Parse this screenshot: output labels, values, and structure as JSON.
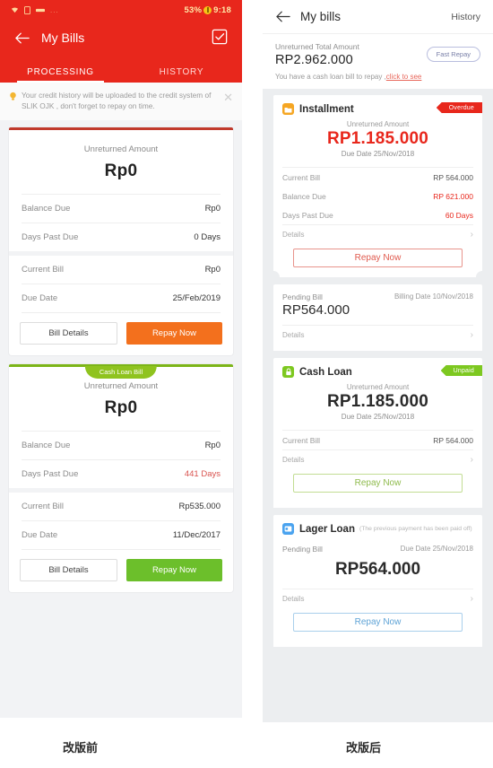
{
  "captions": {
    "before": "改版前",
    "after": "改版后"
  },
  "left_phone": {
    "statusbar": {
      "battery": "53%",
      "time": "9:18",
      "dots": "...",
      "icons": [
        "wifi-icon",
        "sim-card-icon",
        "signal-icon"
      ]
    },
    "navbar": {
      "title": "My Bills",
      "back_icon": "back-arrow-icon",
      "action_icon": "checkbox-list-icon"
    },
    "tabs": [
      {
        "label": "PROCESSING",
        "active": true
      },
      {
        "label": "HISTORY",
        "active": false
      }
    ],
    "notice": {
      "icon": "info-bulb-icon",
      "text": "Your credit history will be uploaded to the credit system of SLIK OJK , don't forget to repay on time.",
      "close_icon": "close-icon"
    },
    "cards": [
      {
        "accent": "#c0392b",
        "tag": null,
        "amount_label": "Unreturned Amount",
        "amount_value": "Rp0",
        "rows": [
          {
            "key": "Balance Due",
            "value": "Rp0",
            "danger": false
          },
          {
            "key": "Days Past Due",
            "value": "0 Days",
            "danger": false
          }
        ],
        "rows2": [
          {
            "key": "Current Bill",
            "value": "Rp0",
            "danger": false
          },
          {
            "key": "Due Date",
            "value": "25/Feb/2019",
            "danger": false
          }
        ],
        "btn_secondary": "Bill Details",
        "btn_primary": "Repay Now",
        "btn_primary_color": "#f3701d"
      },
      {
        "accent": "#7cb518",
        "tag": "Cash Loan Bill",
        "amount_label": "Unreturned Amount",
        "amount_value": "Rp0",
        "rows": [
          {
            "key": "Balance Due",
            "value": "Rp0",
            "danger": false
          },
          {
            "key": "Days Past Due",
            "value": "441 Days",
            "danger": true
          }
        ],
        "rows2": [
          {
            "key": "Current Bill",
            "value": "Rp535.000",
            "danger": false
          },
          {
            "key": "Due Date",
            "value": "11/Dec/2017",
            "danger": false
          }
        ],
        "btn_secondary": "Bill Details",
        "btn_primary": "Repay Now",
        "btn_primary_color": "#6cbf2b"
      }
    ]
  },
  "right_phone": {
    "navbar": {
      "title": "My bills",
      "back_icon": "back-arrow-icon",
      "history_label": "History"
    },
    "summary": {
      "label": "Unreturned Total Amount",
      "amount": "RP2.962.000",
      "fast_repay_label": "Fast Repay",
      "hint_text": "You  have a cash loan bill to repay ,",
      "hint_link": "click to see"
    },
    "installment": {
      "icon": "installment-folder-icon",
      "name": "Installment",
      "badge": "Overdue",
      "amount_label": "Unreturned Amount",
      "amount_value": "RP1.185.000",
      "due_text": "Due Date 25/Nov/2018",
      "rows": [
        {
          "key": "Current Bill",
          "value": "RP 564.000",
          "danger": false
        },
        {
          "key": "Balance Due",
          "value": "RP 621.000",
          "danger": true
        },
        {
          "key": "Days Past Due",
          "value": "60 Days",
          "danger": true
        }
      ],
      "details_label": "Details",
      "button": "Repay Now"
    },
    "pending": {
      "label": "Pending Bill",
      "billing_date": "Billing Date 10/Nov/2018",
      "amount": "RP564.000",
      "details_label": "Details"
    },
    "cash_loan": {
      "icon": "cash-loan-lock-icon",
      "name": "Cash Loan",
      "badge": "Unpaid",
      "amount_label": "Unreturned Amount",
      "amount_value": "RP1.185.000",
      "due_text": "Due Date 25/Nov/2018",
      "rows": [
        {
          "key": "Current Bill",
          "value": "RP 564.000",
          "danger": false
        }
      ],
      "details_label": "Details",
      "button": "Repay Now"
    },
    "lager_loan": {
      "icon": "lager-loan-card-icon",
      "name": "Lager Loan",
      "note": "(The previous payment has been paid off)",
      "pending_label": "Pending Bill",
      "due_text": "Due Date 25/Nov/2018",
      "amount": "RP564.000",
      "details_label": "Details",
      "button": "Repay Now"
    }
  }
}
